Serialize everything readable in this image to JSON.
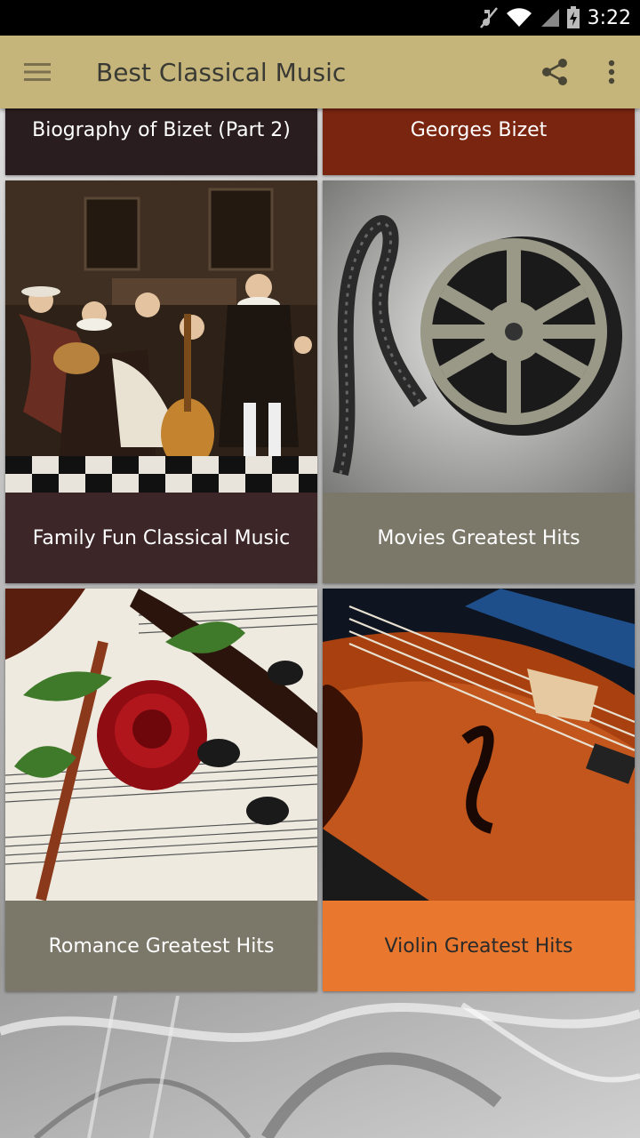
{
  "status_bar": {
    "time": "3:22",
    "icons": [
      "mute-icon",
      "wifi-icon",
      "signal-icon",
      "battery-charging-icon"
    ]
  },
  "app_bar": {
    "title": "Best Classical Music",
    "menu_icon": "hamburger-menu-icon",
    "actions": [
      "share-icon",
      "more-vertical-icon"
    ]
  },
  "cards": [
    {
      "label": "Biography of Bizet (Part 2)",
      "caption_bg": "#2a1d1f",
      "caption_color": "#ffffff"
    },
    {
      "label": "Georges Bizet",
      "caption_bg": "#7a2510",
      "caption_color": "#ffffff"
    },
    {
      "label": "Family Fun Classical Music",
      "caption_bg": "#3d2628",
      "caption_color": "#ffffff",
      "image": "painting-of-musicians"
    },
    {
      "label": "Movies Greatest Hits",
      "caption_bg": "#7b7769",
      "caption_color": "#ffffff",
      "image": "film-reel"
    },
    {
      "label": "Romance Greatest Hits",
      "caption_bg": "#7b7769",
      "caption_color": "#ffffff",
      "image": "violin-with-rose"
    },
    {
      "label": "Violin Greatest Hits",
      "caption_bg": "#e9782e",
      "caption_color": "#2a2a2a",
      "image": "violin-closeup"
    }
  ]
}
